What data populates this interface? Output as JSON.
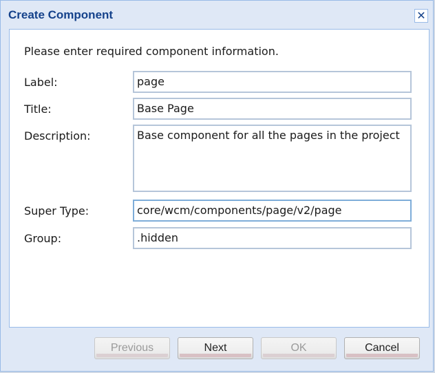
{
  "dialog": {
    "title": "Create Component",
    "close_symbol": "✕",
    "close_icon": "close-icon",
    "intro": "Please enter required component information."
  },
  "fields": {
    "label": {
      "label": "Label:",
      "value": "page"
    },
    "title": {
      "label": "Title:",
      "value": "Base Page"
    },
    "description": {
      "label": "Description:",
      "value": "Base component for all the pages in the project"
    },
    "super_type": {
      "label": "Super Type:",
      "value": "core/wcm/components/page/v2/page"
    },
    "group": {
      "label": "Group:",
      "value": ".hidden"
    }
  },
  "buttons": {
    "previous": {
      "label": "Previous",
      "disabled": true
    },
    "next": {
      "label": "Next",
      "disabled": false
    },
    "ok": {
      "label": "OK",
      "disabled": true
    },
    "cancel": {
      "label": "Cancel",
      "disabled": false
    }
  },
  "colors": {
    "title_text": "#15428b",
    "window_frame": "#dfe8f6",
    "border": "#99bbe8"
  }
}
